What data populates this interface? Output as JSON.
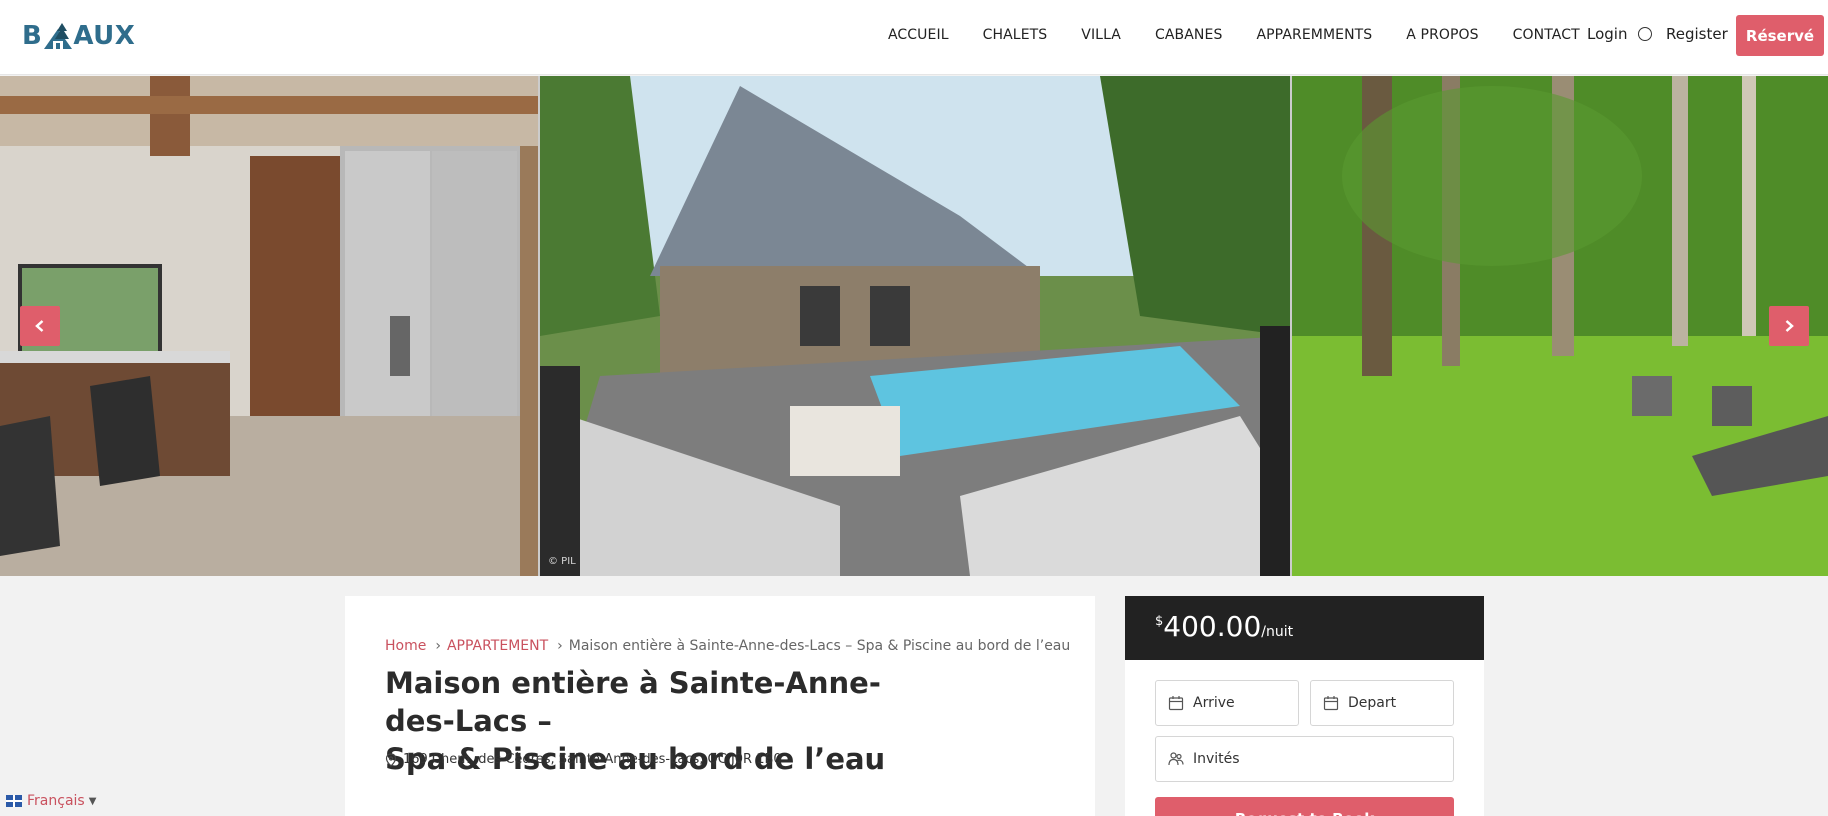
{
  "header": {
    "logo": {
      "text_left": "B",
      "text_right": "AUX",
      "icon": "house-icon"
    },
    "nav": [
      "ACCUEIL",
      "CHALETS",
      "VILLA",
      "CABANES",
      "APPAREMMENTS",
      "A PROPOS",
      "CONTACT"
    ],
    "login_label": "Login",
    "register_label": "Register",
    "reserve_label": "Réservé"
  },
  "gallery": {
    "images": [
      "kitchen interior",
      "stone house with pool",
      "green yard"
    ],
    "credit": "© PIL",
    "prev_icon": "chevron-left-icon",
    "next_icon": "chevron-right-icon"
  },
  "listing": {
    "breadcrumb": {
      "home": "Home",
      "category": "APPARTEMENT",
      "current": "Maison entière à Sainte-Anne-des-Lacs – Spa & Piscine au bord de l’eau"
    },
    "title_line1": "Maison entière à Sainte-Anne-des-Lacs –",
    "title_line2": "Spa & Piscine au bord de l’eau",
    "address": "169 Chem. des Cèdres, Sainte-Anne-des-Lacs, QC J0R 1B0"
  },
  "booking": {
    "currency": "$",
    "price": "400.00",
    "per": "/nuit",
    "arrive_placeholder": "Arrive",
    "depart_placeholder": "Depart",
    "guests_placeholder": "Invités",
    "request_label": "Request to Book"
  },
  "language": {
    "label": "Français",
    "caret": "▼"
  },
  "colors": {
    "accent": "#df5e6b",
    "brand": "#2f6d8c",
    "dark": "#222222"
  }
}
